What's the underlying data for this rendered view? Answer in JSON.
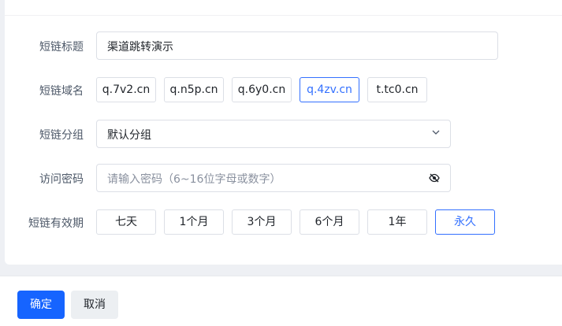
{
  "form": {
    "title_label": "短链标题",
    "title_value": "渠道跳转演示",
    "domain_label": "短链域名",
    "domains": [
      {
        "label": "q.7v2.cn",
        "selected": false
      },
      {
        "label": "q.n5p.cn",
        "selected": false
      },
      {
        "label": "q.6y0.cn",
        "selected": false
      },
      {
        "label": "q.4zv.cn",
        "selected": true
      },
      {
        "label": "t.tc0.cn",
        "selected": false
      }
    ],
    "group_label": "短链分组",
    "group_value": "默认分组",
    "password_label": "访问密码",
    "password_placeholder": "请输入密码（6~16位字母或数字）",
    "validity_label": "短链有效期",
    "validity_options": [
      {
        "label": "七天",
        "selected": false
      },
      {
        "label": "1个月",
        "selected": false
      },
      {
        "label": "3个月",
        "selected": false
      },
      {
        "label": "6个月",
        "selected": false
      },
      {
        "label": "1年",
        "selected": false
      },
      {
        "label": "永久",
        "selected": true
      }
    ]
  },
  "footer": {
    "confirm_label": "确定",
    "cancel_label": "取消"
  },
  "icons": {
    "group_select": "chevron-down-icon",
    "password_toggle": "eye-off-icon"
  },
  "colors": {
    "accent": "#3370ff",
    "primary_button": "#1664ff"
  }
}
